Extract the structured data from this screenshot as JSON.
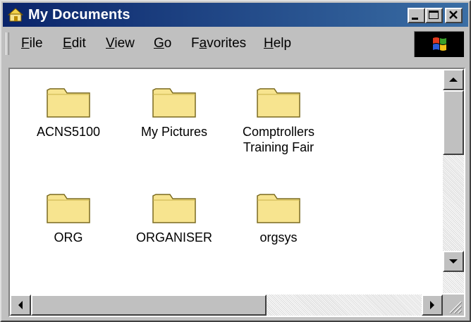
{
  "window": {
    "title": "My Documents",
    "title_icon": "folder-home-icon",
    "controls": [
      "minimize-icon",
      "maximize-icon",
      "close-icon"
    ]
  },
  "menubar": {
    "items": [
      {
        "label": "File",
        "underline": "F"
      },
      {
        "label": "Edit",
        "underline": "E"
      },
      {
        "label": "View",
        "underline": "V"
      },
      {
        "label": "Go",
        "underline": "G"
      },
      {
        "label": "Favorites",
        "underline": "a"
      },
      {
        "label": "Help",
        "underline": "H"
      }
    ],
    "logo_icon": "windows-logo-icon"
  },
  "folders": [
    {
      "label": "ACNS5100",
      "icon": "folder-icon"
    },
    {
      "label": "My Pictures",
      "icon": "folder-icon"
    },
    {
      "label": "Comptrollers\nTraining Fair",
      "icon": "folder-icon"
    },
    {
      "label": "ORG",
      "icon": "folder-icon"
    },
    {
      "label": "ORGANISER",
      "icon": "folder-icon"
    },
    {
      "label": "orgsys",
      "icon": "folder-icon"
    }
  ],
  "colors": {
    "titlebar_start": "#0a246a",
    "titlebar_end": "#3a6ea5",
    "window_face": "#c0c0c0",
    "folder_fill": "#f7e48f"
  }
}
